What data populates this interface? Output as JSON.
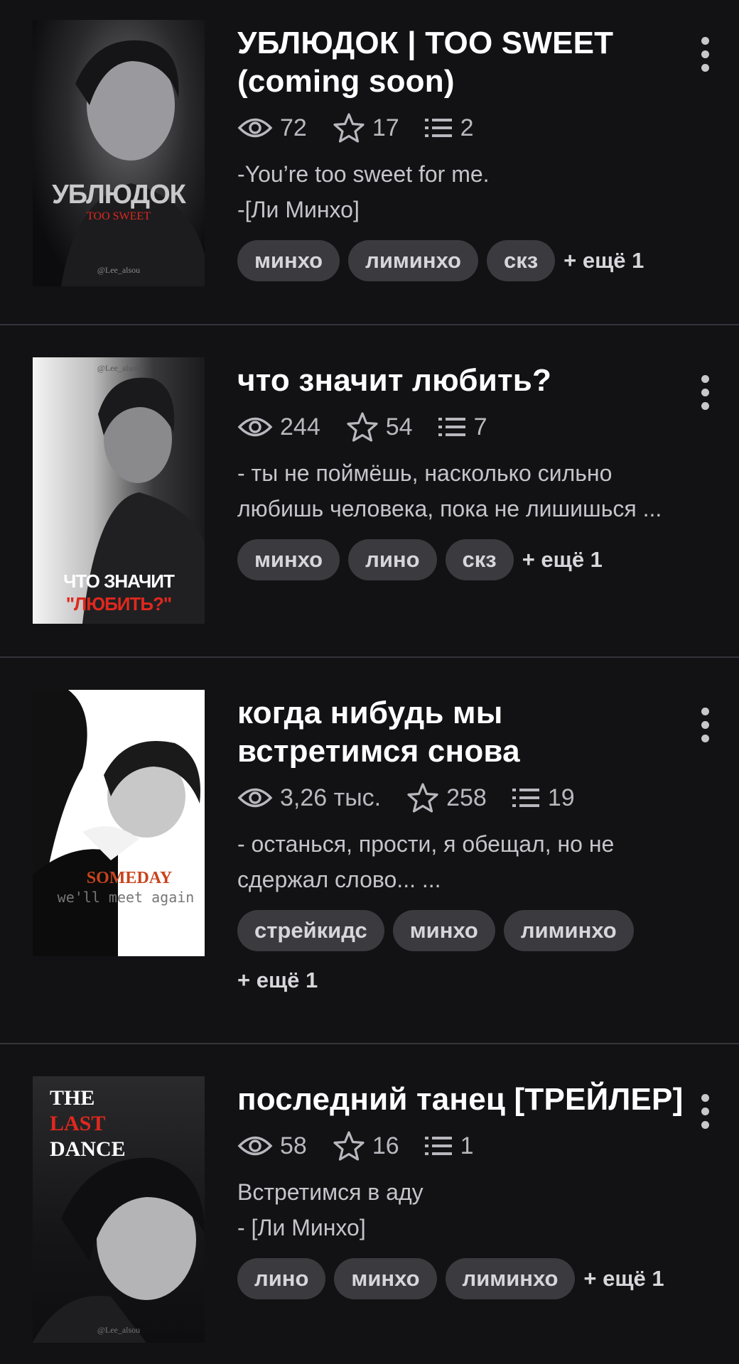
{
  "stories": [
    {
      "title": "УБЛЮДОК | TOO SWEET (coming soon)",
      "views": "72",
      "stars": "17",
      "parts": "2",
      "desc": [
        "-You’re too sweet for me.",
        "-[Ли Минхо]"
      ],
      "tags": [
        "минхо",
        "лиминхо",
        "скз"
      ],
      "more": "+ ещё 1",
      "cover_text": [
        "УБЛЮДОК",
        "TOO SWEET",
        "@Lee_alsou"
      ]
    },
    {
      "title": "что значит любить?",
      "views": "244",
      "stars": "54",
      "parts": "7",
      "desc": [
        "- ты не поймёшь, насколько сильно",
        "любишь человека, пока не лишишься ..."
      ],
      "tags": [
        "минхо",
        "лино",
        "скз"
      ],
      "more": "+ ещё 1",
      "cover_text": [
        "@Lee_alsou",
        "ЧТО ЗНАЧИТ",
        "\"ЛЮБИТЬ?\""
      ]
    },
    {
      "title": "когда нибудь мы встретимся снова",
      "views": "3,26 тыс.",
      "stars": "258",
      "parts": "19",
      "desc": [
        "- останься, прости, я обещал, но не",
        "сдержал слово... ..."
      ],
      "tags": [
        "стрейкидс",
        "минхо",
        "лиминхо"
      ],
      "more": "+ ещё 1",
      "cover_text": [
        "SOMEDAY",
        "we'll meet again"
      ]
    },
    {
      "title": "последний танец [ТРЕЙЛЕР]",
      "views": "58",
      "stars": "16",
      "parts": "1",
      "desc": [
        "Встретимся в аду",
        "- [Ли Минхо]"
      ],
      "tags": [
        "лино",
        "минхо",
        "лиминхо"
      ],
      "more": "+ ещё 1",
      "cover_text": [
        "THE",
        "LAST",
        "DANCE",
        "@Lee_alsou"
      ]
    }
  ],
  "colors": {
    "background": "#121215",
    "divider": "#34343a",
    "tag_bg": "#3a3a3f",
    "muted_text": "#b8b8be",
    "cover_red": "#e0281e"
  },
  "icons": [
    "eye-icon",
    "star-icon",
    "list-icon",
    "more-vertical-icon"
  ]
}
